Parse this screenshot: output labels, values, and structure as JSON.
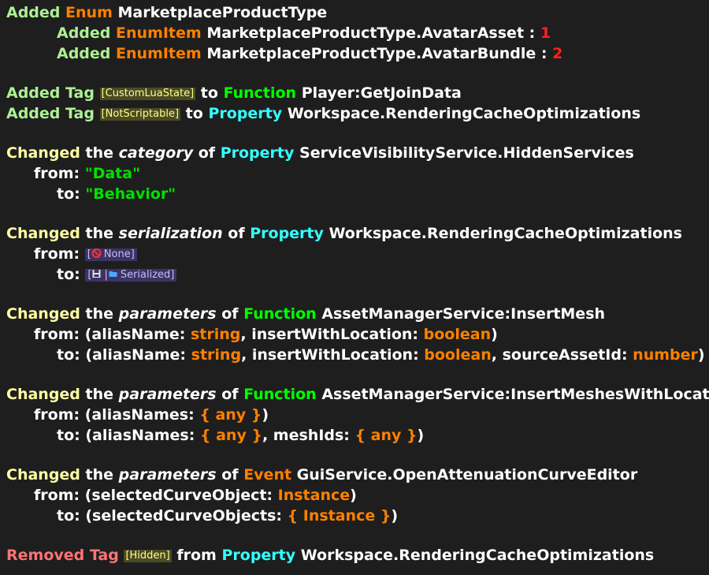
{
  "words": {
    "added": "Added",
    "changed": "Changed",
    "removed": "Removed",
    "the": "the",
    "of": "of",
    "to": "to",
    "from_word": "from",
    "from_label": "from:",
    "to_label": "to:",
    "tag": "Tag",
    "enum": "Enum",
    "enumitem": "EnumItem",
    "function": "Function",
    "property": "Property",
    "event": "Event"
  },
  "lines": {
    "enum_name": "MarketplaceProductType",
    "item1_name": "MarketplaceProductType.AvatarAsset",
    "item1_value": "1",
    "item2_name": "MarketplaceProductType.AvatarBundle",
    "item2_value": "2",
    "tag1": "[CustomLuaState]",
    "tag1_target": "Player:GetJoinData",
    "tag2": "[NotScriptable]",
    "tag2_target": "Workspace.RenderingCacheOptimizations",
    "cat_word": "category",
    "cat_target": "ServiceVisibilityService.HiddenServices",
    "cat_from": "\"Data\"",
    "cat_to": "\"Behavior\"",
    "ser_word": "serialization",
    "ser_target": "Workspace.RenderingCacheOptimizations",
    "ser_from": "None]",
    "ser_to": "Serialized]",
    "params_word": "parameters",
    "im_target": "AssetManagerService:InsertMesh",
    "im_from_a": "(aliasName: ",
    "im_from_b": "string",
    "im_from_c": ", insertWithLocation: ",
    "im_from_d": "boolean",
    "im_from_e": ")",
    "im_to_a": "(aliasName: ",
    "im_to_b": "string",
    "im_to_c": ", insertWithLocation: ",
    "im_to_d": "boolean",
    "im_to_e": ", sourceAssetId: ",
    "im_to_f": "number",
    "im_to_g": ")",
    "imwl_target": "AssetManagerService:InsertMeshesWithLocation",
    "imwl_from_a": "(aliasNames: ",
    "imwl_from_b": "{ any }",
    "imwl_from_c": ")",
    "imwl_to_a": "(aliasNames: ",
    "imwl_to_b": "{ any }",
    "imwl_to_c": ", meshIds: ",
    "imwl_to_d": "{ any }",
    "imwl_to_e": ")",
    "ev_target": "GuiService.OpenAttenuationCurveEditor",
    "ev_from_a": "(selectedCurveObject: ",
    "ev_from_b": "Instance",
    "ev_from_c": ")",
    "ev_to_a": "(selectedCurveObjects: ",
    "ev_to_b": "{ Instance }",
    "ev_to_c": ")",
    "rm_tag": "[Hidden]",
    "rm_target": "Workspace.RenderingCacheOptimizations"
  },
  "icons": {
    "none_icon": "no-entry-icon",
    "floppy_icon": "floppy-disk-icon",
    "folder_icon": "folder-icon"
  },
  "colors": {
    "background": "#1e1e1e",
    "added": "#adf195",
    "changed": "#fffea3",
    "removed": "#ff7373",
    "enum": "#ff8000",
    "function": "#00ff00",
    "property": "#35ffff",
    "number": "#ff2020",
    "string": "#00e000"
  }
}
